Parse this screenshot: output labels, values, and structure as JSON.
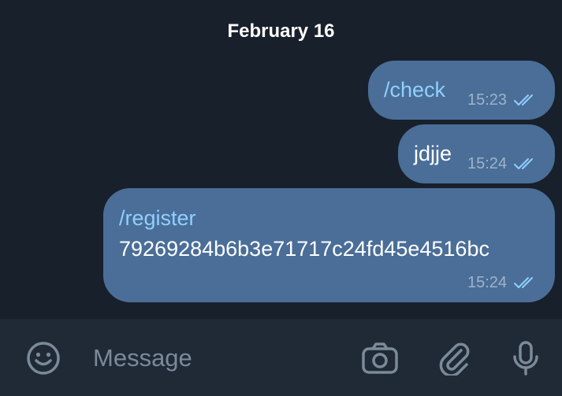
{
  "date_separator": "February 16",
  "messages": [
    {
      "lines": [
        {
          "text": "/check",
          "kind": "command"
        }
      ],
      "time": "15:23",
      "status": "read"
    },
    {
      "lines": [
        {
          "text": "jdjje",
          "kind": "plain"
        }
      ],
      "time": "15:24",
      "status": "read"
    },
    {
      "lines": [
        {
          "text": "/register",
          "kind": "command"
        },
        {
          "text": "79269284b6b3e71717c24fd45e4516bc",
          "kind": "plain"
        }
      ],
      "time": "15:24",
      "status": "read"
    }
  ],
  "input_bar": {
    "placeholder": "Message",
    "icons": [
      "emoji-icon",
      "camera-icon",
      "paperclip-icon",
      "microphone-icon"
    ]
  },
  "colors": {
    "background": "#18202b",
    "bubble": "#4a6e98",
    "command_text": "#8fd0ff",
    "time_text": "#9fb3c8",
    "input_bar": "#202a36"
  }
}
